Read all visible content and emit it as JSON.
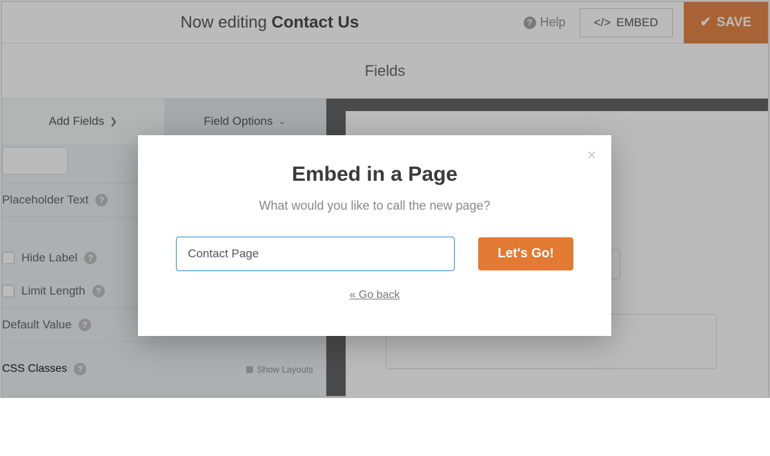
{
  "header": {
    "editing_prefix": "Now editing ",
    "editing_title": "Contact Us",
    "help_label": "Help",
    "embed_label": "EMBED",
    "save_label": "SAVE"
  },
  "subheader": {
    "label": "Fields"
  },
  "sidebar": {
    "tab_add": "Add Fields",
    "tab_options": "Field Options",
    "placeholder_label": "Placeholder Text",
    "hide_label": "Hide Label",
    "limit_length": "Limit Length",
    "default_value": "Default Value",
    "css_classes": "CSS Classes",
    "show_layouts": "Show Layouts"
  },
  "modal": {
    "title": "Embed in a Page",
    "subtitle": "What would you like to call the new page?",
    "input_value": "Contact Page",
    "go_label": "Let's Go!",
    "back_label": "« Go back"
  }
}
